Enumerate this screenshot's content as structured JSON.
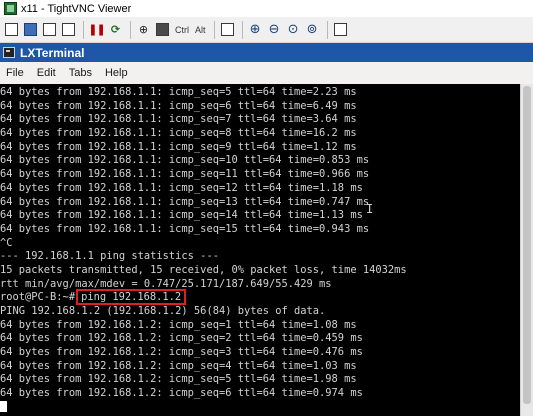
{
  "vnc": {
    "title": "x11 - TightVNC Viewer",
    "toolbar": {
      "ctrl_label": "Ctrl",
      "alt_label": "Alt"
    }
  },
  "terminal_window": {
    "title": "LXTerminal",
    "menu": [
      "File",
      "Edit",
      "Tabs",
      "Help"
    ]
  },
  "terminal": {
    "lines_top": [
      "64 bytes from 192.168.1.1: icmp_seq=5 ttl=64 time=2.23 ms",
      "64 bytes from 192.168.1.1: icmp_seq=6 ttl=64 time=6.49 ms",
      "64 bytes from 192.168.1.1: icmp_seq=7 ttl=64 time=3.64 ms",
      "64 bytes from 192.168.1.1: icmp_seq=8 ttl=64 time=16.2 ms",
      "64 bytes from 192.168.1.1: icmp_seq=9 ttl=64 time=1.12 ms",
      "64 bytes from 192.168.1.1: icmp_seq=10 ttl=64 time=0.853 ms",
      "64 bytes from 192.168.1.1: icmp_seq=11 ttl=64 time=0.966 ms",
      "64 bytes from 192.168.1.1: icmp_seq=12 ttl=64 time=1.18 ms",
      "64 bytes from 192.168.1.1: icmp_seq=13 ttl=64 time=0.747 ms",
      "64 bytes from 192.168.1.1: icmp_seq=14 ttl=64 time=1.13 ms",
      "64 bytes from 192.168.1.1: icmp_seq=15 ttl=64 time=0.943 ms",
      "^C",
      "--- 192.168.1.1 ping statistics ---",
      "15 packets transmitted, 15 received, 0% packet loss, time 14032ms",
      "rtt min/avg/max/mdev = 0.747/25.171/187.649/55.429 ms"
    ],
    "prompt": "root@PC-B:~#",
    "command": "ping 192.168.1.2",
    "lines_bottom": [
      "PING 192.168.1.2 (192.168.1.2) 56(84) bytes of data.",
      "64 bytes from 192.168.1.2: icmp_seq=1 ttl=64 time=1.08 ms",
      "64 bytes from 192.168.1.2: icmp_seq=2 ttl=64 time=0.459 ms",
      "64 bytes from 192.168.1.2: icmp_seq=3 ttl=64 time=0.476 ms",
      "64 bytes from 192.168.1.2: icmp_seq=4 ttl=64 time=1.03 ms",
      "64 bytes from 192.168.1.2: icmp_seq=5 ttl=64 time=1.98 ms",
      "64 bytes from 192.168.1.2: icmp_seq=6 ttl=64 time=0.974 ms"
    ]
  },
  "colors": {
    "terminal_bg": "#000000",
    "terminal_fg": "#d3d3d3",
    "titlebar": "#1e56a8",
    "highlight_box": "#e02020"
  }
}
